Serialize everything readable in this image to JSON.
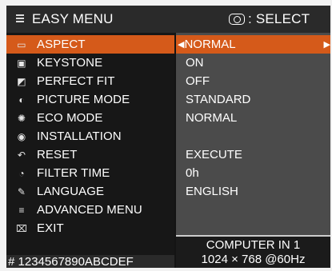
{
  "header": {
    "title": "EASY MENU",
    "select_hint": ": SELECT"
  },
  "menu_items": [
    {
      "label": "ASPECT",
      "value": "NORMAL",
      "icon": "aspect-icon",
      "active": true
    },
    {
      "label": "KEYSTONE",
      "value": "ON",
      "icon": "keystone-icon"
    },
    {
      "label": "PERFECT FIT",
      "value": "OFF",
      "icon": "perfect-fit-icon"
    },
    {
      "label": "PICTURE MODE",
      "value": "STANDARD",
      "icon": "picture-mode-icon"
    },
    {
      "label": "ECO MODE",
      "value": "NORMAL",
      "icon": "eco-mode-icon"
    },
    {
      "label": "INSTALLATION",
      "value": "",
      "icon": "installation-icon"
    },
    {
      "label": "RESET",
      "value": "EXECUTE",
      "icon": "reset-icon"
    },
    {
      "label": "FILTER TIME",
      "value": "0h",
      "icon": "filter-time-icon"
    },
    {
      "label": "LANGUAGE",
      "value": "ENGLISH",
      "icon": "language-icon"
    },
    {
      "label": "ADVANCED MENU",
      "value": "",
      "icon": "advanced-menu-icon"
    },
    {
      "label": "EXIT",
      "value": "",
      "icon": "exit-icon"
    }
  ],
  "footer": {
    "serial": "# 1234567890ABCDEF",
    "source_line1": "COMPUTER IN 1",
    "source_line2": "1024 × 768 @60Hz"
  },
  "colors": {
    "highlight": "#d55a1a",
    "header_bg": "#2a2a2a",
    "left_bg": "#171717",
    "right_bg": "#4b4b4b"
  }
}
